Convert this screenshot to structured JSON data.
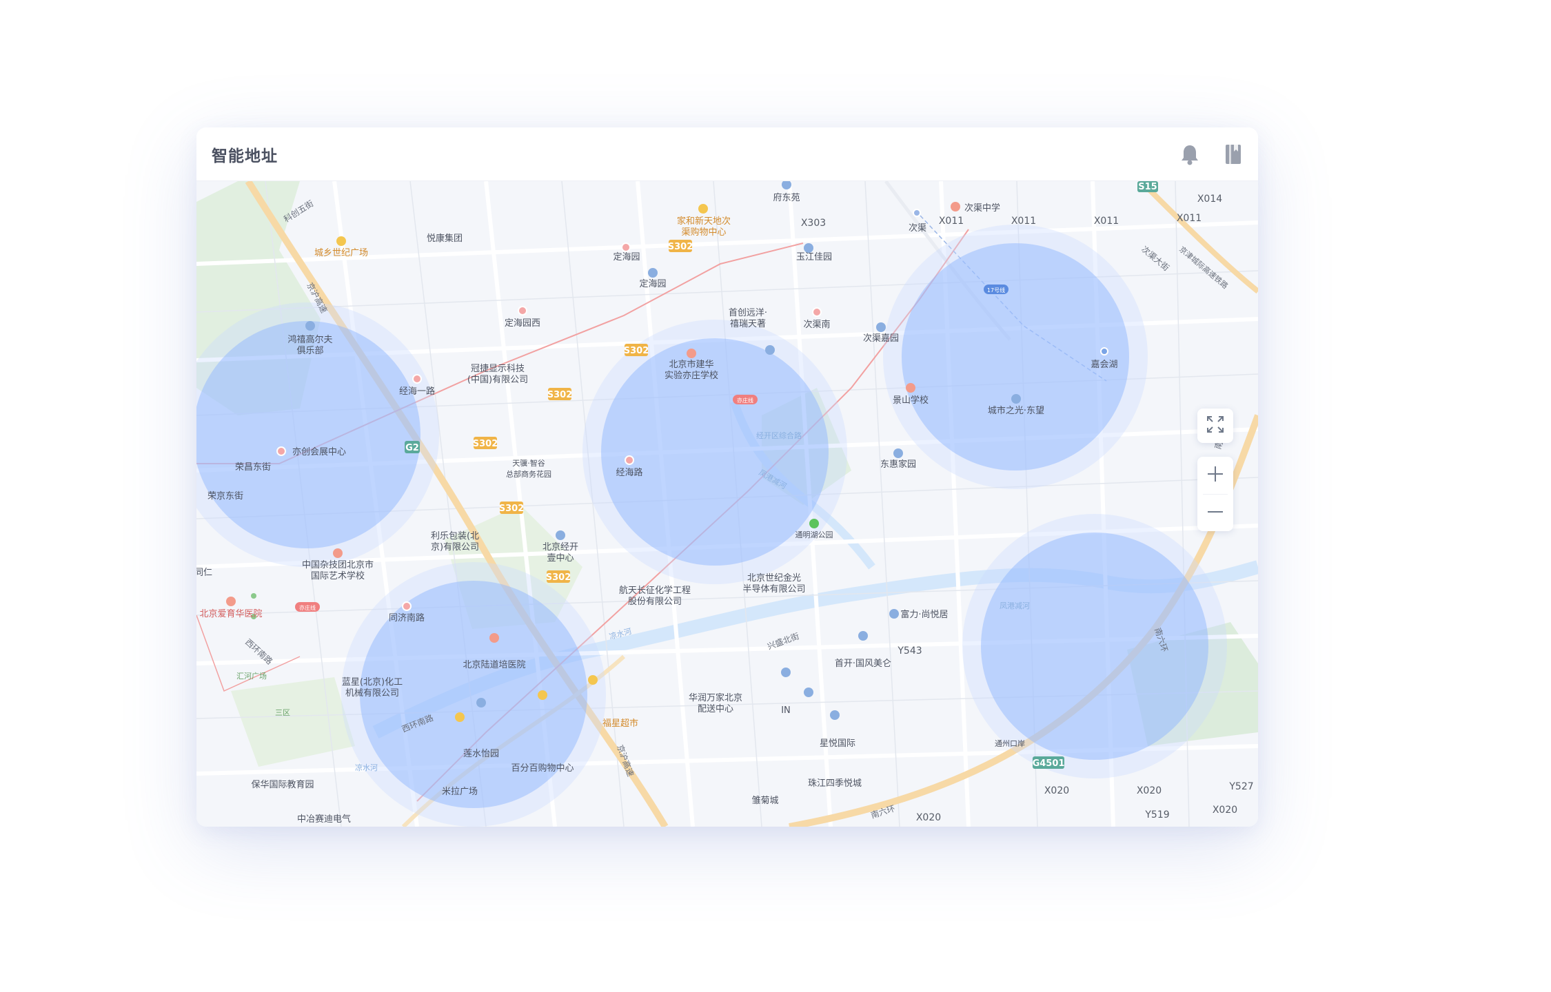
{
  "app": {
    "title": "智能地址"
  },
  "header_icons": [
    "bell-icon",
    "book-icon"
  ],
  "controls": [
    "fullscreen-icon",
    "zoom-in-icon",
    "zoom-out-icon"
  ],
  "colors": {
    "zone_fill": "#8fb6ff",
    "zone_halo": "#c9dbff",
    "road_major": "#f7d9a6",
    "water": "#d4e7fb",
    "metro": "#f07f7f"
  },
  "coverage_zones": 5,
  "roads": {
    "s302_a": "S302",
    "s302_b": "S302",
    "s302_c": "S302",
    "s302_d": "S302",
    "s302_e": "S302",
    "s302_f": "S302",
    "g2": "G2",
    "s15": "S15",
    "g4501": "G4501",
    "x014": "X014",
    "x303": "X303",
    "x011_a": "X011",
    "x011_b": "X011",
    "x011_c": "X011",
    "x011_d": "X011",
    "y543": "Y543",
    "x020_a": "X020",
    "x020_b": "X020",
    "x020_c": "X020",
    "x020_d": "X020",
    "y519": "Y519",
    "y527": "Y527"
  },
  "street_labels": {
    "kechuang_5": "科创五街",
    "jinghu_east": "京沪高速",
    "rongjing_e": "荣京东街",
    "xihuan_s": "西环南路",
    "xihuan_s2": "西环南路",
    "jinghu_s": "京沪高速",
    "xingsheng_n": "兴盛北街",
    "nanliuhuan": "南六环",
    "nanliuhuan2": "南六环",
    "cijing_av": "凉水河",
    "liangshuihe": "凉水河",
    "cicun_ave": "次渠大街",
    "jingjin_railway": "京津城际高速铁路",
    "huihe": "凤港减河",
    "jingjin_road": "经开区综合路"
  },
  "places": {
    "fudongyuan": "府东苑",
    "cigu_middle": "次渠中学",
    "jiahe": "家和新天地次",
    "jiahe2": "渠购物中心",
    "chengxiang": "城乡世纪广场",
    "yuekang": "悦康集团",
    "dinghaiyuan": "定海园",
    "dinghaiyuan2": "定海园",
    "yujiang": "玉江佳园",
    "cigu": "次渠",
    "cigu_south": "次渠南",
    "cigu_jiayuan": "次渠嘉园",
    "dinghai_west": "定海园西",
    "hongfu": "鸿禧高尔夫",
    "hongfu2": "俱乐部",
    "shouchuang": "首创远洋·",
    "shouchuang2": "禧瑞天著",
    "guanjie": "冠捷显示科技",
    "guanjie2": "(中国)有限公司",
    "jianhua": "北京市建华",
    "jianhua2": "实验亦庄学校",
    "jinghai_1": "经海一路",
    "jiahui_lake": "嘉会湖",
    "jingshan_school": "景山学校",
    "chengshi": "城市之光·东望",
    "yichuang": "亦创会展中心",
    "rongchang": "荣昌东街",
    "rongjing": "荣京东街",
    "tianmo": "天骥·智谷",
    "tianmo2": "总部商务花园",
    "jinghai_rd": "经海路",
    "donghui": "东惠家园",
    "lile": "利乐包装(北",
    "lile2": "京)有限公司",
    "jingkai_one": "北京经开",
    "jingkai_one2": "壹中心",
    "tongming_lake": "通明湖公园",
    "zhongguo_acro": "中国杂技团北京市",
    "zhongguo_acro2": "国际艺术学校",
    "hangtian": "航天长征化学工程",
    "hangtian2": "股份有限公司",
    "shiji_jinguang": "北京世纪金光",
    "shiji_jinguang2": "半导体有限公司",
    "tongren": "同仁",
    "aiyu": "北京爱育华医院",
    "tongji": "同济南路",
    "fuli": "富力·尚悦居",
    "shoukai": "首开·国风美仑",
    "huiheguang": "汇河广场",
    "sanqu": "三区",
    "lanxing": "蓝星(北京)化工",
    "lanxing2": "机械有限公司",
    "luqiao": "北京陆道培医院",
    "huarun": "华润万家北京",
    "huarun2": "配送中心",
    "in": "IN",
    "xingyue": "星悦国际",
    "fuxing": "福星超市",
    "lianshui": "莲水怡园",
    "baifen": "百分百购物中心",
    "baohua": "保华国际教育园",
    "mila": "米拉广场",
    "zhujiang": "珠江四季悦城",
    "zhongye": "中冶赛迪电气",
    "chrysanthemum": "雏菊城",
    "tongzhoukou": "通州口岸",
    "yizhuangline": "亦庄线",
    "line17": "17号线",
    "yizhuangline2": "亦庄线",
    "liangshui_label": "凉水河",
    "honghui": "凤港减河"
  }
}
